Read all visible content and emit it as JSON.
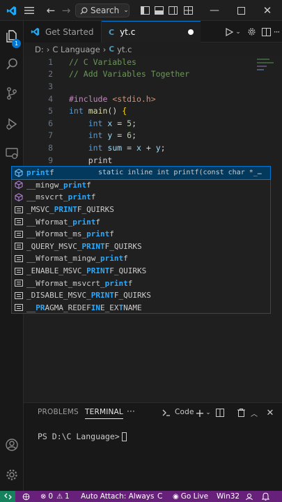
{
  "titlebar": {
    "search_label": "Search"
  },
  "activity": {
    "explorer_badge": "1"
  },
  "tabs": [
    {
      "label": "Get Started"
    },
    {
      "label": "yt.c",
      "icon_text": "C"
    }
  ],
  "breadcrumb": {
    "drive": "D:",
    "folder": "C Language",
    "file_icon": "C",
    "file": "yt.c"
  },
  "editor": {
    "lines": [
      {
        "n": "1",
        "text": "// C Variables"
      },
      {
        "n": "2",
        "text": "// Add Variables Together"
      },
      {
        "n": "3",
        "text": ""
      },
      {
        "n": "4",
        "text": "#include <stdio.h>"
      },
      {
        "n": "5",
        "text": "int main() {"
      },
      {
        "n": "6",
        "text": "    int x = 5;"
      },
      {
        "n": "7",
        "text": "    int y = 6;"
      },
      {
        "n": "8",
        "text": "    int sum = x + y;"
      },
      {
        "n": "9",
        "text": "    print"
      }
    ]
  },
  "suggest": {
    "detail": "static inline int printf(const char *_…",
    "items": [
      {
        "label": "printf",
        "kind": "function"
      },
      {
        "label": "__mingw_printf",
        "kind": "function"
      },
      {
        "label": "__msvcrt_printf",
        "kind": "function"
      },
      {
        "label": "_MSVC_PRINTF_QUIRKS",
        "kind": "macro"
      },
      {
        "label": "__Wformat_printf",
        "kind": "macro"
      },
      {
        "label": "__Wformat_ms_printf",
        "kind": "macro"
      },
      {
        "label": "_QUERY_MSVC_PRINTF_QUIRKS",
        "kind": "macro"
      },
      {
        "label": "__Wformat_mingw_printf",
        "kind": "macro"
      },
      {
        "label": "_ENABLE_MSVC_PRINTF_QUIRKS",
        "kind": "macro"
      },
      {
        "label": "__Wformat_msvcrt_printf",
        "kind": "macro"
      },
      {
        "label": "_DISABLE_MSVC_PRINTF_QUIRKS",
        "kind": "macro"
      },
      {
        "label": "__PRAGMA_REDEFINE_EXTNAME",
        "kind": "macro"
      }
    ]
  },
  "panel": {
    "tabs": [
      "PROBLEMS",
      "TERMINAL"
    ],
    "more": "···",
    "terminal_name": "Code",
    "prompt": "PS D:\\C Language>"
  },
  "statusbar": {
    "errors": "0",
    "warnings": "1",
    "auto_attach": "Auto Attach: Always",
    "language": "C",
    "go_live": "Go Live",
    "platform": "Win32"
  },
  "colors": {
    "accent": "#0078d4",
    "statusbar": "#68217a",
    "remote": "#16825d"
  }
}
